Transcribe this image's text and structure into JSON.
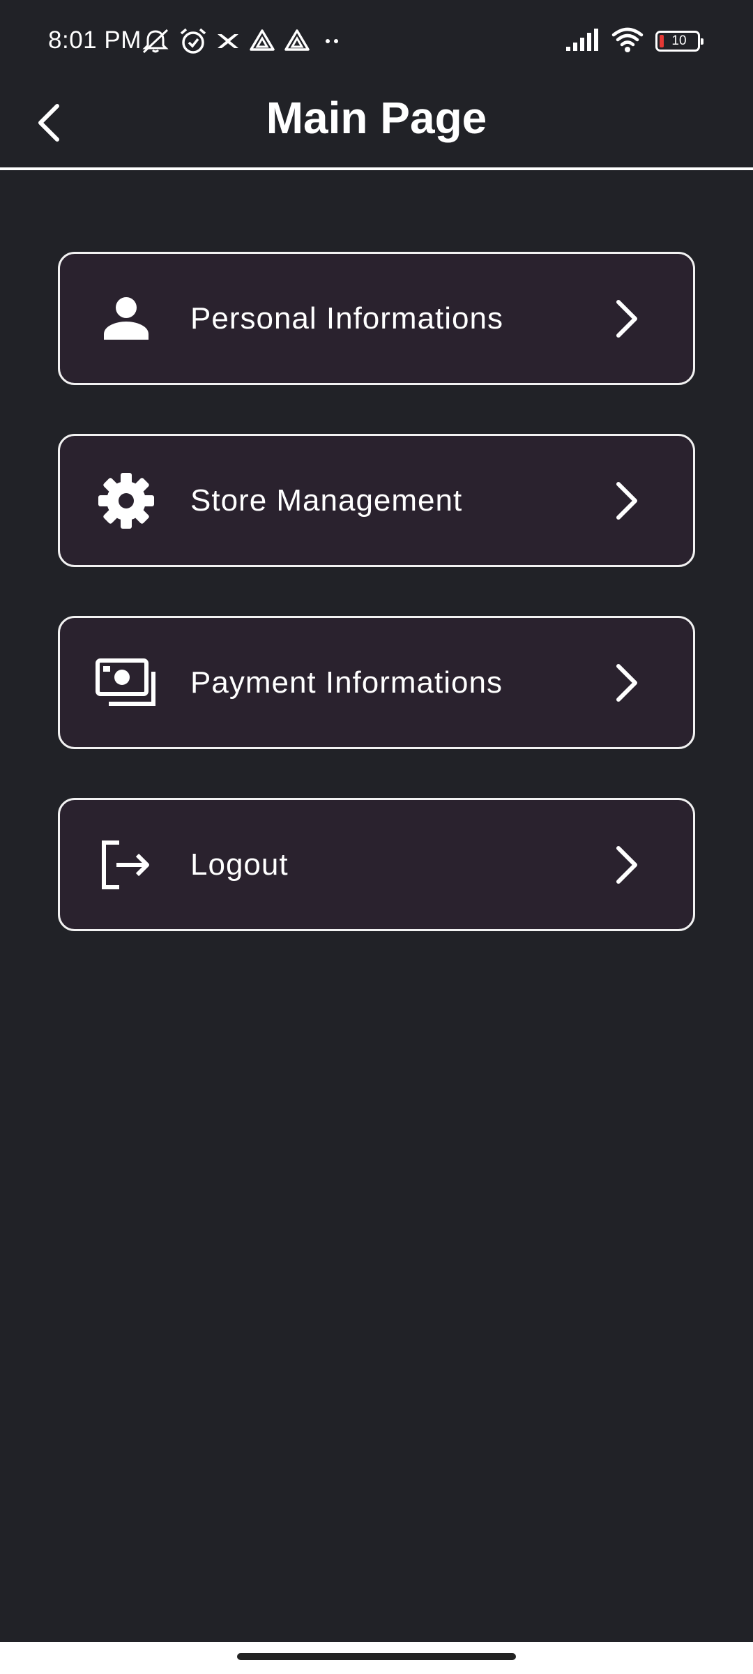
{
  "status_bar": {
    "time": "8:01 PM",
    "battery_level": "10",
    "left_icons": [
      "mute-icon",
      "alarm-icon",
      "app-notification-icon",
      "drive-icon",
      "drive-icon",
      "more-dots-icon"
    ],
    "right_icons": [
      "signal-icon",
      "wifi-icon",
      "battery-icon"
    ]
  },
  "app_bar": {
    "title": "Main Page",
    "back_icon": "chevron-left-icon"
  },
  "menu": {
    "items": [
      {
        "label": "Personal Informations",
        "icon": "person-icon"
      },
      {
        "label": "Store Management",
        "icon": "gear-icon"
      },
      {
        "label": "Payment Informations",
        "icon": "payments-icon"
      },
      {
        "label": "Logout",
        "icon": "logout-icon"
      }
    ]
  },
  "colors": {
    "background": "#212227",
    "card_background": "#2a222e",
    "card_border": "#f2f2f2",
    "text": "#ffffff",
    "battery_low": "#e53935"
  }
}
